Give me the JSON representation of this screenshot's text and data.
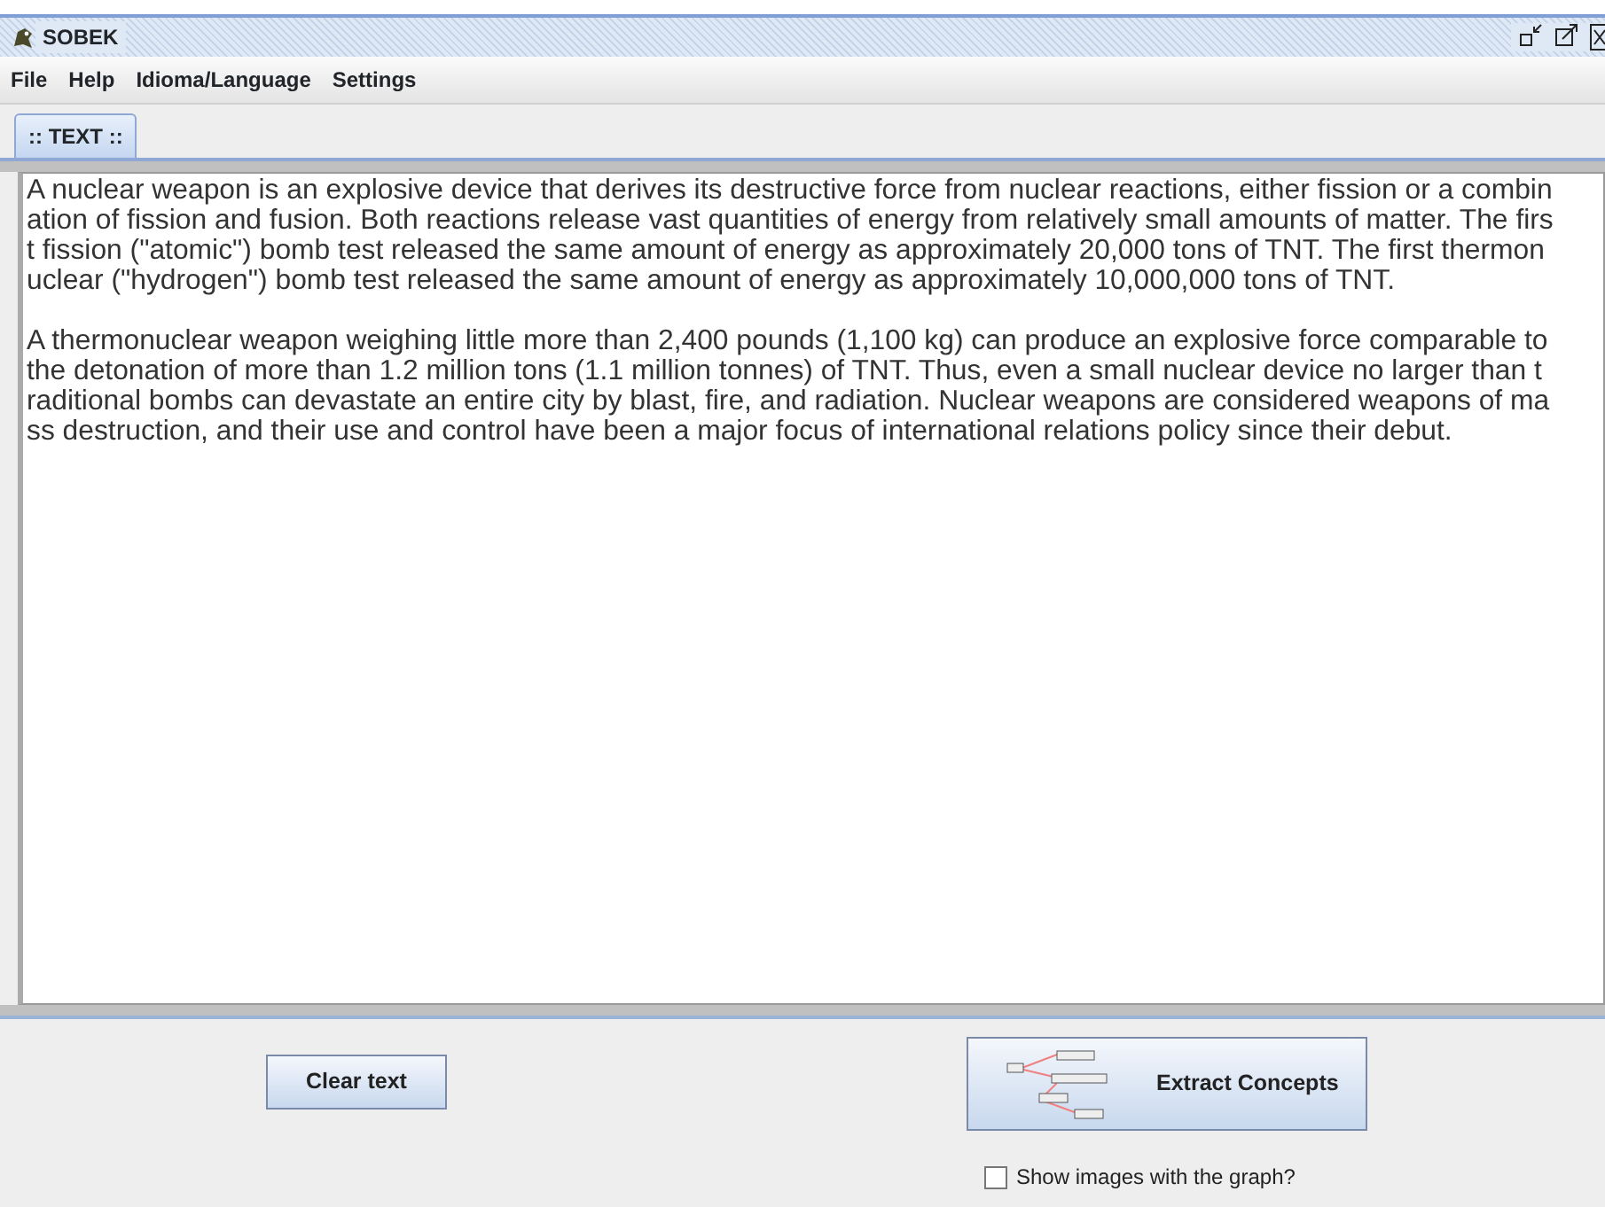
{
  "window": {
    "title": "SOBEK"
  },
  "menu": [
    "File",
    "Help",
    "Idioma/Language",
    "Settings"
  ],
  "tabs": [
    {
      "label": ":: TEXT ::",
      "selected": true
    }
  ],
  "text_area": {
    "paragraphs": [
      [
        "A nuclear weapon is an explosive device that derives its destructive force from nuclear reactions, either fission or a combin",
        "ation of fission and fusion. Both reactions release vast quantities of energy from relatively small amounts of matter. The firs",
        "t fission (\"atomic\") bomb test released the same amount of energy as approximately 20,000 tons of TNT. The first thermon",
        "uclear (\"hydrogen\") bomb test released the same amount of energy as approximately 10,000,000 tons of TNT."
      ],
      [
        "A thermonuclear weapon weighing little more than 2,400 pounds (1,100 kg) can produce an explosive force comparable to",
        "the detonation of more than 1.2 million tons (1.1 million tonnes) of TNT. Thus, even a small nuclear device no larger than t",
        "raditional bombs can devastate an entire city by blast, fire, and radiation. Nuclear weapons are considered weapons of ma",
        "ss destruction, and their use and control have been a major focus of international relations policy since their debut."
      ]
    ]
  },
  "buttons": {
    "clear": "Clear text",
    "extract": "Extract Concepts"
  },
  "checkbox": {
    "label": "Show images with the graph?",
    "checked": false
  }
}
